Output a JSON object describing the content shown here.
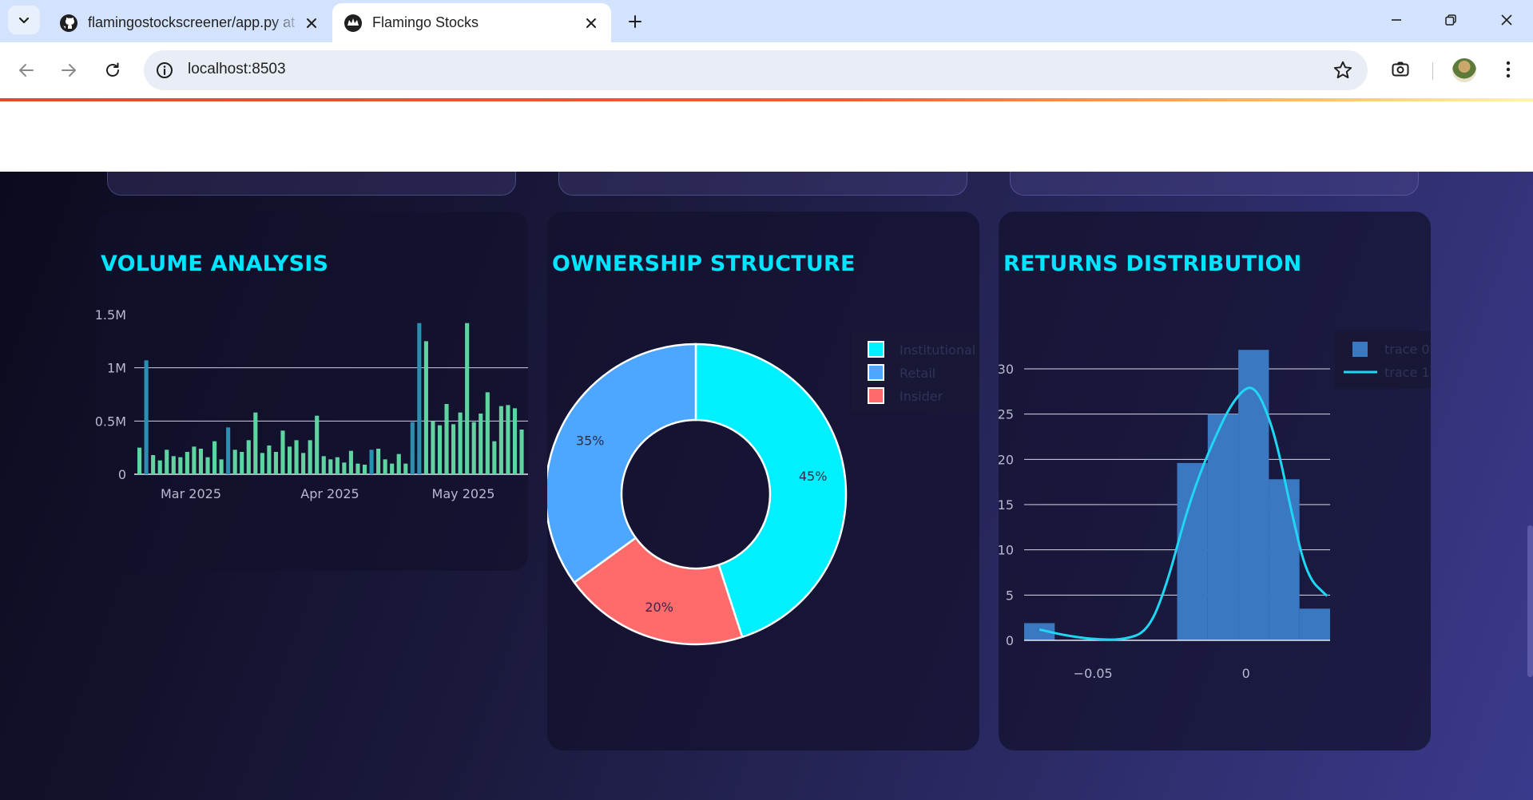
{
  "browser": {
    "tabs": [
      {
        "title": "flamingostockscreener/app.py at",
        "active": false,
        "icon": "github-icon"
      },
      {
        "title": "Flamingo Stocks",
        "active": true,
        "icon": "streamlit-icon"
      }
    ],
    "url": "localhost:8503"
  },
  "cards": {
    "volume": {
      "title": "VOLUME ANALYSIS"
    },
    "ownership": {
      "title": "OWNERSHIP STRUCTURE"
    },
    "returns": {
      "title": "RETURNS DISTRIBUTION"
    }
  },
  "colors": {
    "accent_title": "#00e5ff",
    "volume_up": "#5fd3a0",
    "volume_down": "#2a8fb0",
    "institutional": "#00f0ff",
    "retail": "#4da6ff",
    "insider": "#ff6b6b",
    "histogram": "#3b78c2",
    "kde": "#1fd7f2"
  },
  "chart_data": [
    {
      "type": "bar",
      "title": "VOLUME ANALYSIS",
      "x_tick_labels": [
        "Mar 2025",
        "Apr 2025",
        "May 2025"
      ],
      "y_tick_labels": [
        "0",
        "0.5M",
        "1M",
        "1.5M"
      ],
      "ylim": [
        0,
        1500000
      ],
      "grid": true,
      "series": [
        {
          "values": [
            250000,
            1070000,
            180000,
            130000,
            230000,
            170000,
            160000,
            210000,
            260000,
            240000,
            160000,
            310000,
            140000,
            440000,
            230000,
            210000,
            320000,
            580000,
            200000,
            270000,
            210000,
            410000,
            260000,
            320000,
            200000,
            320000,
            550000,
            170000,
            140000,
            160000,
            110000,
            220000,
            100000,
            90000,
            230000,
            240000,
            140000,
            100000,
            190000,
            100000,
            490000,
            1420000,
            1250000,
            500000,
            460000,
            660000,
            470000,
            580000,
            1420000,
            490000,
            570000,
            770000,
            310000,
            640000,
            650000,
            620000,
            420000
          ]
        }
      ]
    },
    {
      "type": "pie",
      "title": "OWNERSHIP STRUCTURE",
      "categories": [
        "Institutional",
        "Retail",
        "Insider"
      ],
      "values": [
        45,
        35,
        20
      ],
      "slice_labels": [
        "45%",
        "35%",
        "20%"
      ],
      "hole": true,
      "legend": "top-right"
    },
    {
      "type": "bar",
      "title": "RETURNS DISTRIBUTION",
      "x_tick_labels": [
        "−0.05",
        "0"
      ],
      "y_tick_labels": [
        "0",
        "5",
        "10",
        "15",
        "20",
        "25",
        "30"
      ],
      "ylim": [
        0,
        32
      ],
      "grid": true,
      "legend": "top-right",
      "bins": [
        {
          "x0": -0.0725,
          "x1": -0.0625,
          "count": 1.9
        },
        {
          "x0": -0.0225,
          "x1": -0.0125,
          "count": 19.6
        },
        {
          "x0": -0.0125,
          "x1": -0.0025,
          "count": 25
        },
        {
          "x0": -0.0025,
          "x1": 0.0075,
          "count": 32.1
        },
        {
          "x0": 0.0075,
          "x1": 0.0175,
          "count": 17.8
        },
        {
          "x0": 0.0175,
          "x1": 0.0275,
          "count": 3.5
        }
      ],
      "series": [
        {
          "name": "trace 0",
          "type": "histogram"
        },
        {
          "name": "trace 1",
          "type": "line",
          "x": [
            -0.0675,
            -0.06,
            -0.05,
            -0.04,
            -0.032,
            -0.026,
            -0.02,
            -0.015,
            -0.01,
            -0.005,
            0,
            0.003,
            0.006,
            0.01,
            0.015,
            0.02,
            0.0265
          ],
          "y": [
            1.2,
            0.6,
            0.1,
            0.05,
            1.0,
            6.0,
            13.5,
            18.5,
            22.5,
            26.0,
            28.0,
            27.8,
            26.0,
            22.0,
            14.0,
            7.0,
            4.9
          ]
        }
      ]
    }
  ]
}
